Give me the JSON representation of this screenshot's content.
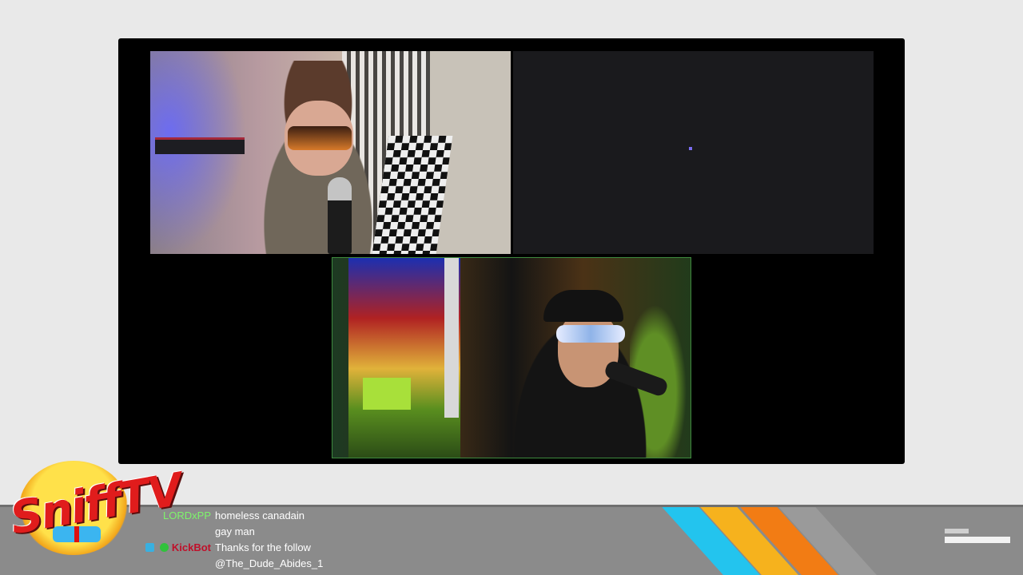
{
  "chat": {
    "messages": [
      {
        "user": "LORDxPP",
        "text": "homeless canadain"
      },
      {
        "user": "",
        "text": "gay man"
      },
      {
        "user": "KickBot",
        "text": "Thanks for the follow"
      },
      {
        "user": "",
        "text": "@The_Dude_Abides_1"
      }
    ]
  },
  "logo": {
    "text": "SniffTV"
  },
  "colors": {
    "stripe_blue": "#23c4ee",
    "stripe_yellow": "#f6b21d",
    "stripe_orange": "#f27c14",
    "chat_user_green": "#7ef56b",
    "bot_red": "#c0102a"
  },
  "icons": [
    "platform-badge-icon",
    "verified-badge-icon"
  ]
}
